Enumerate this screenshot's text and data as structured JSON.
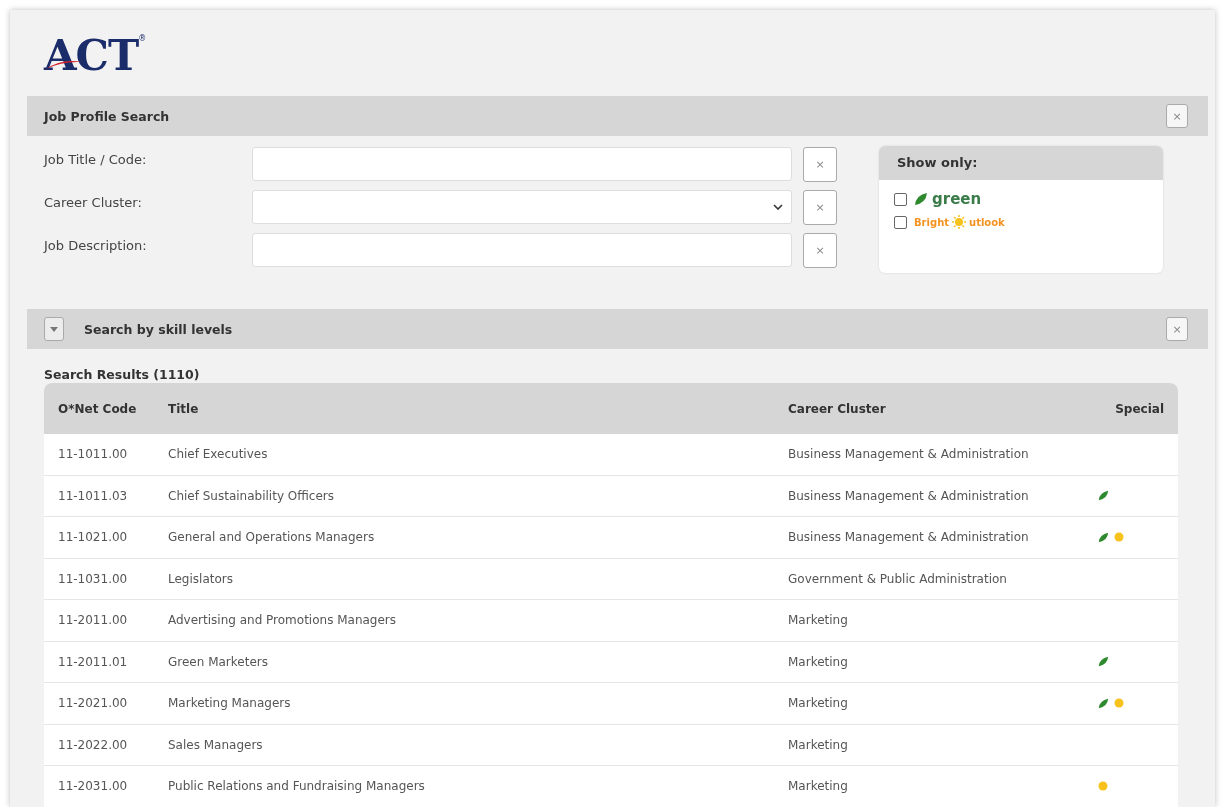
{
  "logo": {
    "text": "ACT",
    "mark": "®"
  },
  "search_panel": {
    "title": "Job Profile Search",
    "close": "×",
    "fields": [
      {
        "label": "Job Title / Code:",
        "kind": "text",
        "clear": "×"
      },
      {
        "label": "Career Cluster:",
        "kind": "select",
        "clear": "×"
      },
      {
        "label": "Job Description:",
        "kind": "text",
        "clear": "×"
      }
    ],
    "show_only": {
      "title": "Show only:",
      "options": [
        {
          "kind": "green",
          "text": "green",
          "checked": false
        },
        {
          "kind": "bright",
          "text_before": "Bright",
          "text_after": "utlook",
          "checked": false
        }
      ]
    }
  },
  "skill_panel": {
    "title": "Search by skill levels",
    "expanded": false,
    "close": "×"
  },
  "results": {
    "title": "Search Results (1110)",
    "columns": [
      "O*Net Code",
      "Title",
      "Career Cluster",
      "Special"
    ],
    "rows": [
      {
        "code": "11-1011.00",
        "title": "Chief Executives",
        "cluster": "Business Management & Administration",
        "green": false,
        "bright": false
      },
      {
        "code": "11-1011.03",
        "title": "Chief Sustainability Officers",
        "cluster": "Business Management & Administration",
        "green": true,
        "bright": false
      },
      {
        "code": "11-1021.00",
        "title": "General and Operations Managers",
        "cluster": "Business Management & Administration",
        "green": true,
        "bright": true
      },
      {
        "code": "11-1031.00",
        "title": "Legislators",
        "cluster": "Government & Public Administration",
        "green": false,
        "bright": false
      },
      {
        "code": "11-2011.00",
        "title": "Advertising and Promotions Managers",
        "cluster": "Marketing",
        "green": false,
        "bright": false
      },
      {
        "code": "11-2011.01",
        "title": "Green Marketers",
        "cluster": "Marketing",
        "green": true,
        "bright": false
      },
      {
        "code": "11-2021.00",
        "title": "Marketing Managers",
        "cluster": "Marketing",
        "green": true,
        "bright": true
      },
      {
        "code": "11-2022.00",
        "title": "Sales Managers",
        "cluster": "Marketing",
        "green": false,
        "bright": false
      },
      {
        "code": "11-2031.00",
        "title": "Public Relations and Fundraising Managers",
        "cluster": "Marketing",
        "green": false,
        "bright": true
      }
    ]
  }
}
